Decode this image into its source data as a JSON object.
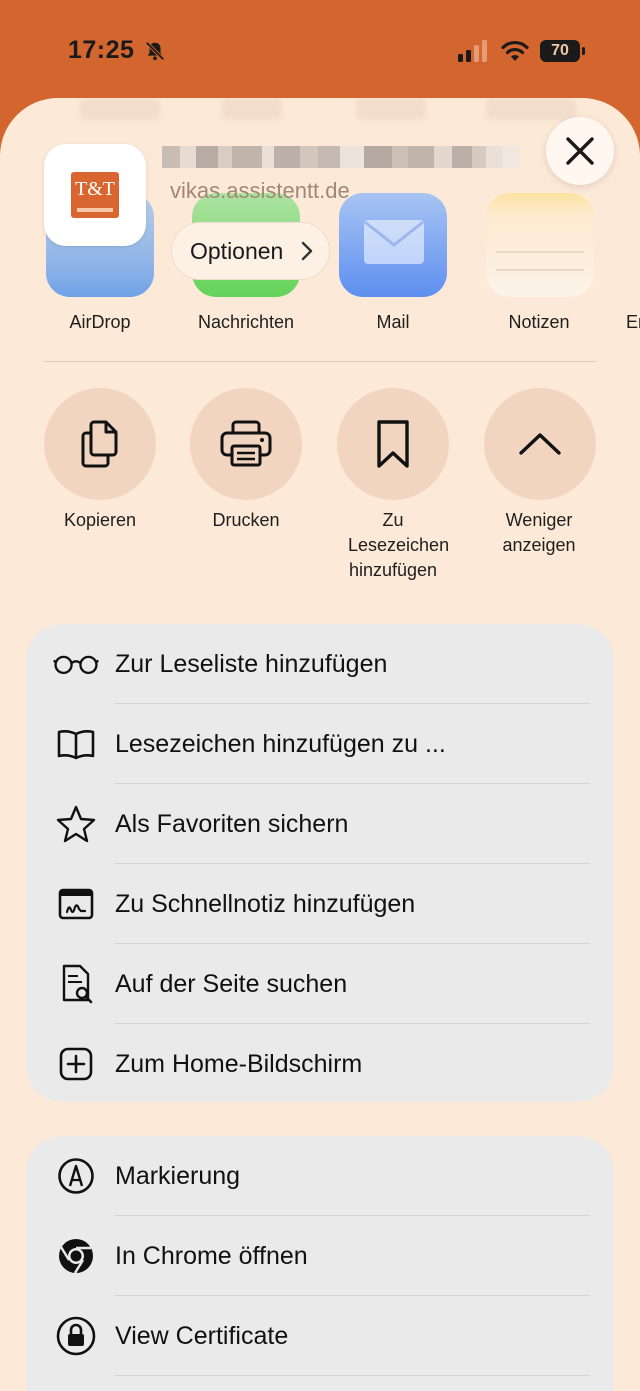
{
  "status_bar": {
    "time": "17:25",
    "battery_level": "70"
  },
  "share_header": {
    "site_logo_text": "T&T",
    "url": "vikas.assistentt.de",
    "options_label": "Optionen",
    "close_icon": "close-icon"
  },
  "apps": [
    {
      "label": "AirDrop",
      "icon": "airdrop-icon"
    },
    {
      "label": "Nachrichten",
      "icon": "messages-icon"
    },
    {
      "label": "Mail",
      "icon": "mail-icon"
    },
    {
      "label": "Notizen",
      "icon": "notes-icon"
    },
    {
      "label": "Er",
      "icon": "app-icon"
    }
  ],
  "actions": [
    {
      "label": "Kopieren",
      "icon": "copy-icon"
    },
    {
      "label": "Drucken",
      "icon": "printer-icon"
    },
    {
      "label": "Zu Lesezeichen hinzufügen",
      "icon": "bookmark-icon"
    },
    {
      "label": "Weniger anzeigen",
      "icon": "chevron-up-icon"
    }
  ],
  "menu_group_1": [
    {
      "label": "Zur Leseliste hinzufügen",
      "icon": "glasses-icon"
    },
    {
      "label": "Lesezeichen hinzufügen zu ...",
      "icon": "book-icon"
    },
    {
      "label": "Als Favoriten sichern",
      "icon": "star-icon"
    },
    {
      "label": "Zu Schnellnotiz hinzufügen",
      "icon": "quick-note-icon"
    },
    {
      "label": "Auf der Seite suchen",
      "icon": "find-in-page-icon"
    },
    {
      "label": "Zum Home-Bildschirm",
      "icon": "add-square-icon"
    }
  ],
  "menu_group_2": [
    {
      "label": "Markierung",
      "icon": "markup-icon"
    },
    {
      "label": "In Chrome öffnen",
      "icon": "chrome-icon"
    },
    {
      "label": "View Certificate",
      "icon": "lock-icon"
    }
  ]
}
